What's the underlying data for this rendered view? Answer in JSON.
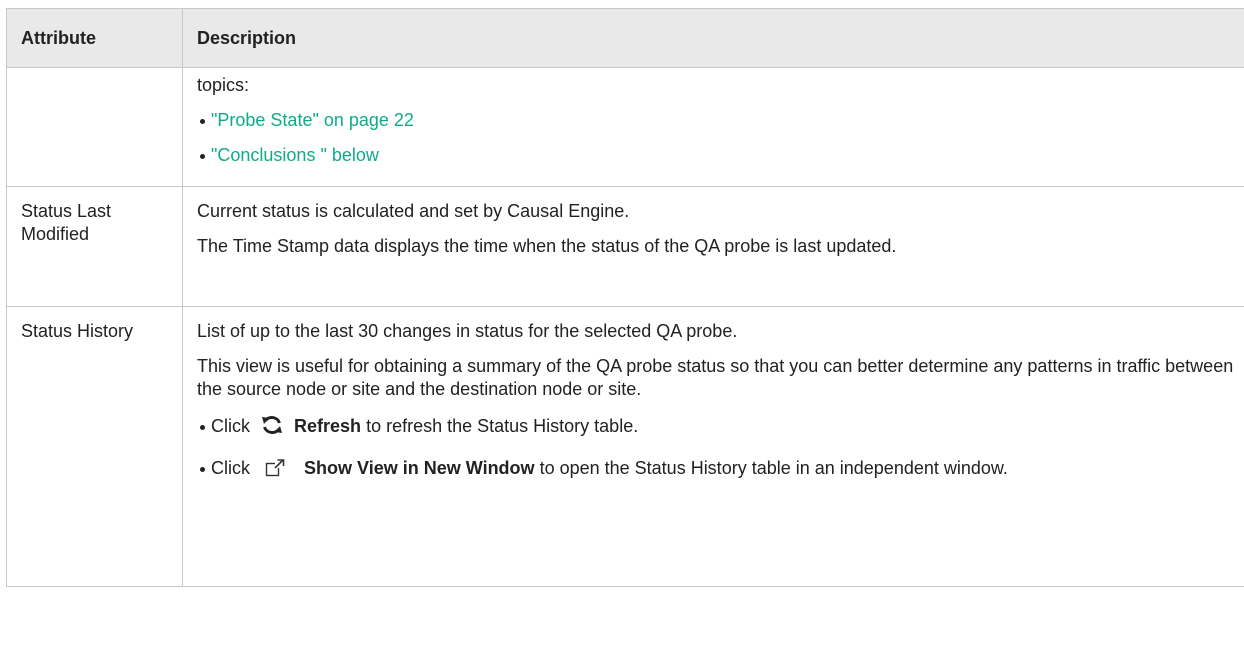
{
  "table": {
    "headers": {
      "attribute": "Attribute",
      "description": "Description"
    },
    "row_topics": {
      "intro": "topics:",
      "links": [
        "\"Probe State\" on page 22",
        "\"Conclusions \" below"
      ]
    },
    "row_modified": {
      "attribute": "Status Last Modified",
      "paragraphs": [
        "Current status is calculated and set by Causal Engine.",
        "The Time Stamp data displays the time when the status of the QA probe is last updated."
      ]
    },
    "row_history": {
      "attribute": "Status History",
      "paragraphs": [
        "List of up to the last 30 changes in status for the selected QA probe.",
        "This view is useful for obtaining a summary of the QA probe status so that you can better determine any patterns in traffic between the source node or site and the destination node or site."
      ],
      "refresh_item": {
        "prefix": "Click",
        "icon": "refresh-icon",
        "label": "Refresh",
        "suffix": "to refresh the Status History table."
      },
      "new_window_item": {
        "prefix": "Click",
        "icon": "external-window-icon",
        "label": "Show View in New Window",
        "suffix": "to open the Status History table in an independent window."
      }
    }
  },
  "colors": {
    "link": "#0eab8a",
    "header_bg": "#e9e9e9",
    "border": "#c8c8c8"
  }
}
